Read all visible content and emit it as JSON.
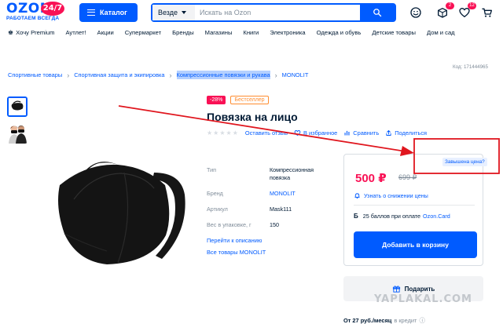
{
  "header": {
    "logo_main": "OZON",
    "logo_badge": "24/7",
    "logo_sub": "РАБОТАЕМ ВСЕГДА",
    "catalog_label": "Каталог",
    "search_scope": "Везде",
    "search_placeholder": "Искать на Ozon",
    "cart_count": "2",
    "favorites_count": "12"
  },
  "nav": {
    "items": [
      "Хочу Premium",
      "Аутлет!",
      "Акции",
      "Супермаркет",
      "Бренды",
      "Магазины",
      "Книги",
      "Электроника",
      "Одежда и обувь",
      "Детские товары",
      "Дом и сад"
    ]
  },
  "breadcrumbs": [
    "Спортивные товары",
    "Спортивная защита и экипировка",
    "Компрессионные повязки и рукава",
    "MONOLIT"
  ],
  "product_code": "Код: 171444965",
  "product": {
    "discount_tag": "-28%",
    "bestseller_tag": "Бестселлер",
    "title": "Повязка на лицо",
    "review_link": "Оставить отзыв",
    "favorites_link": "В избранное",
    "compare_link": "Сравнить",
    "share_link": "Поделиться",
    "props": [
      {
        "key": "Тип",
        "value": "Компрессионная повязка"
      },
      {
        "key": "Бренд",
        "value": "MONOLIT"
      },
      {
        "key": "Артикул",
        "value": "Mask111"
      },
      {
        "key": "Вес в упаковке, г",
        "value": "150"
      }
    ],
    "to_description": "Перейти к описанию",
    "all_brand": "Все товары MONOLIT"
  },
  "price_card": {
    "price_now": "500 ₽",
    "price_old": "699 ₽",
    "price_alert": "Узнать о снижении цены",
    "bonus_letter": "Б",
    "bonus_text": "25 баллов при оплате",
    "bonus_link": "Ozon.Card",
    "cart_button": "Добавить в корзину",
    "overpriced": "Завышена цена?"
  },
  "gift": {
    "label": "Подарить"
  },
  "credit": {
    "amount": "От 27 руб./месяц",
    "suffix": "в кредит"
  },
  "watermark": "YAPLAKAL.COM",
  "colors": {
    "brand_blue": "#005bff",
    "accent_pink": "#f91155",
    "annotation_red": "#e0161e",
    "bestseller_orange": "#ff8c2f"
  }
}
